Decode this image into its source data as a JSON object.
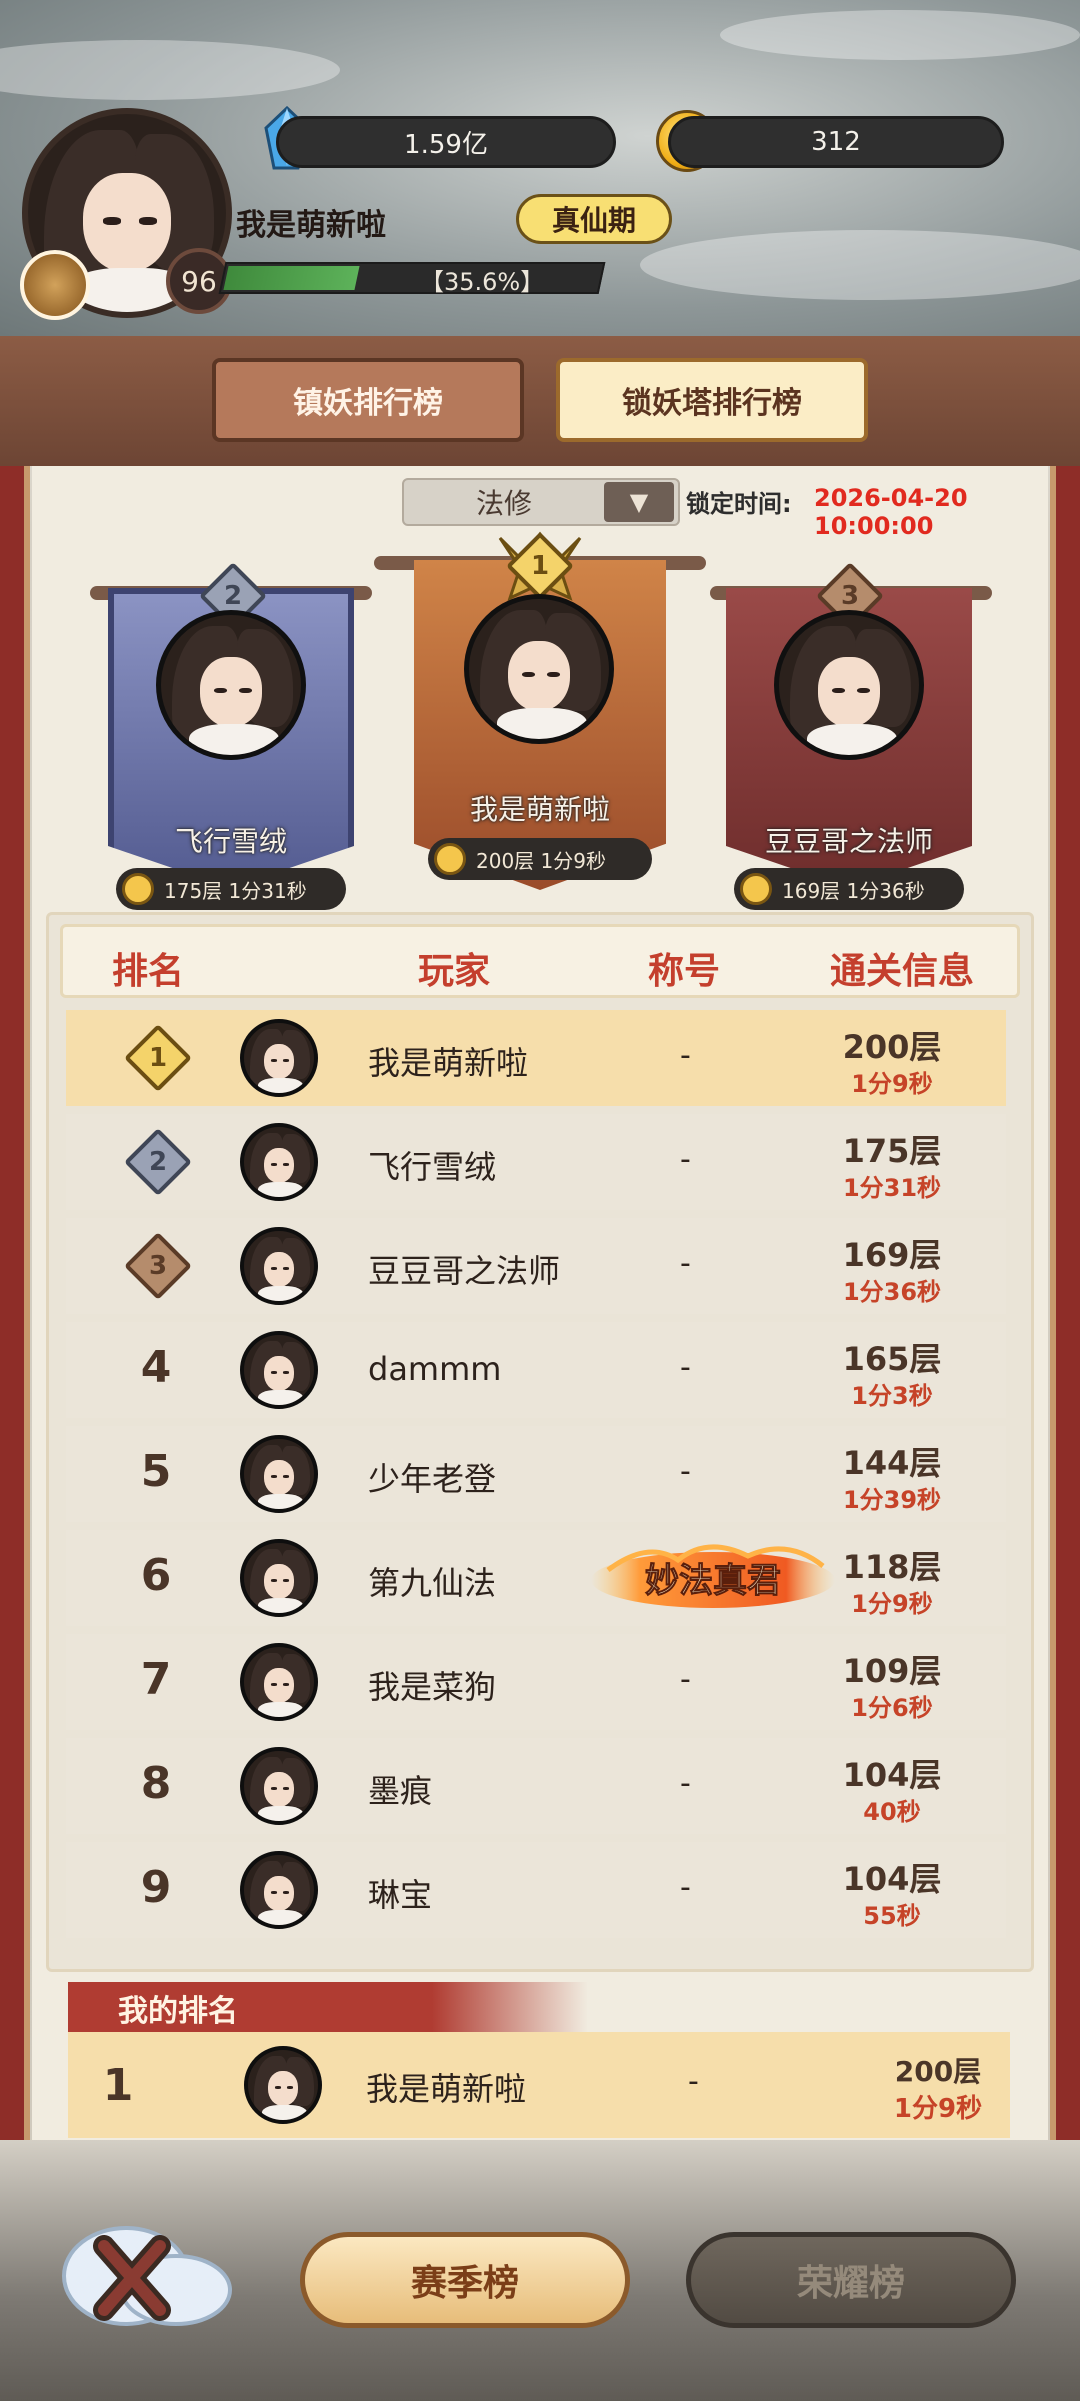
{
  "header": {
    "crystal_amount": "1.59亿",
    "gold_amount": "312",
    "player_name": "我是萌新啦",
    "realm": "真仙期",
    "level": "96",
    "exp_text": "【35.6%】",
    "exp_fraction": 0.356
  },
  "tabs": [
    {
      "label": "镇妖排行榜",
      "active": false
    },
    {
      "label": "锁妖塔排行榜",
      "active": true
    }
  ],
  "filter": {
    "class_selected": "法修",
    "lock_label": "锁定时间:",
    "lock_time": "2026-04-20 10:00:00"
  },
  "podium": {
    "first": {
      "rank": "1",
      "name": "我是萌新啦",
      "info": "200层  1分9秒"
    },
    "second": {
      "rank": "2",
      "name": "飞行雪绒",
      "info": "175层  1分31秒"
    },
    "third": {
      "rank": "3",
      "name": "豆豆哥之法师",
      "info": "169层  1分36秒"
    }
  },
  "table": {
    "headers": [
      "排名",
      "玩家",
      "称号",
      "通关信息"
    ],
    "rows": [
      {
        "rank": "1",
        "name": "我是萌新啦",
        "title": "-",
        "floor": "200层",
        "time": "1分9秒"
      },
      {
        "rank": "2",
        "name": "飞行雪绒",
        "title": "-",
        "floor": "175层",
        "time": "1分31秒"
      },
      {
        "rank": "3",
        "name": "豆豆哥之法师",
        "title": "-",
        "floor": "169层",
        "time": "1分36秒"
      },
      {
        "rank": "4",
        "name": "dammm",
        "title": "-",
        "floor": "165层",
        "time": "1分3秒"
      },
      {
        "rank": "5",
        "name": "少年老登",
        "title": "-",
        "floor": "144层",
        "time": "1分39秒"
      },
      {
        "rank": "6",
        "name": "第九仙法",
        "title": "妙法真君",
        "floor": "118层",
        "time": "1分9秒"
      },
      {
        "rank": "7",
        "name": "我是菜狗",
        "title": "-",
        "floor": "109层",
        "time": "1分6秒"
      },
      {
        "rank": "8",
        "name": "墨痕",
        "title": "-",
        "floor": "104层",
        "time": "40秒"
      },
      {
        "rank": "9",
        "name": "琳宝",
        "title": "-",
        "floor": "104层",
        "time": "55秒"
      }
    ]
  },
  "my_rank": {
    "heading": "我的排名",
    "rank": "1",
    "name": "我是萌新啦",
    "title": "-",
    "floor": "200层",
    "time": "1分9秒"
  },
  "bottom": {
    "season_label": "赛季榜",
    "honor_label": "荣耀榜"
  },
  "colors": {
    "accent_red": "#c43f2d",
    "time_red": "#e12a1f",
    "first_row": "#f6deab",
    "gold": "#f0ad16"
  }
}
